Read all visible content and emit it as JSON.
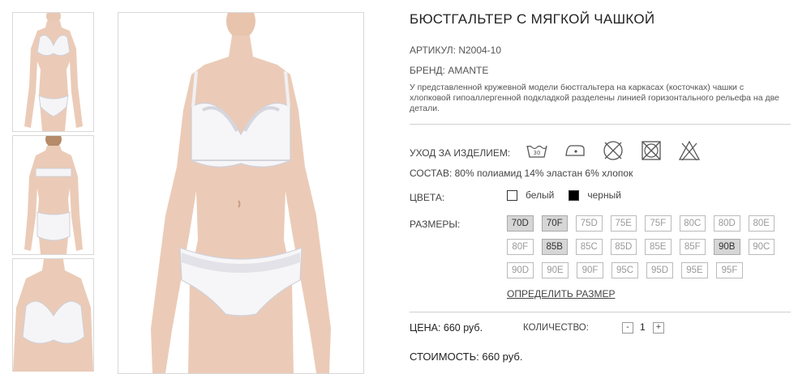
{
  "product": {
    "title": "БЮСТГАЛЬТЕР С МЯГКОЙ ЧАШКОЙ",
    "article": "АРТИКУЛ: N2004-10",
    "brand": "БРЕНД: AMANTE",
    "description": "У представленной кружевной модели бюстгальтера на каркасах (косточках) чашки с хлопковой гипоаллергенной подкладкой разделены линией горизонтального рельефа на две детали."
  },
  "care": {
    "label": "УХОД ЗА ИЗДЕЛИЕМ:",
    "icons": [
      "wash-30-icon",
      "iron-low-icon",
      "no-dry-clean-icon",
      "no-tumble-dry-icon",
      "no-bleach-icon"
    ]
  },
  "composition": "СОСТАВ: 80% полиамид 14% эластан 6% хлопок",
  "colors": {
    "label": "ЦВЕТА:",
    "options": [
      {
        "label": "белый",
        "hex": "#ffffff"
      },
      {
        "label": "черный",
        "hex": "#000000"
      }
    ]
  },
  "sizes": {
    "label": "РАЗМЕРЫ:",
    "rows": [
      [
        {
          "v": "70D",
          "available": true
        },
        {
          "v": "70F",
          "available": true
        },
        {
          "v": "75D",
          "available": false
        },
        {
          "v": "75E",
          "available": false
        },
        {
          "v": "75F",
          "available": false
        },
        {
          "v": "80C",
          "available": false
        },
        {
          "v": "80D",
          "available": false
        },
        {
          "v": "80E",
          "available": false
        }
      ],
      [
        {
          "v": "80F",
          "available": false
        },
        {
          "v": "85B",
          "available": true
        },
        {
          "v": "85C",
          "available": false
        },
        {
          "v": "85D",
          "available": false
        },
        {
          "v": "85E",
          "available": false
        },
        {
          "v": "85F",
          "available": false
        },
        {
          "v": "90B",
          "available": true
        },
        {
          "v": "90C",
          "available": false
        }
      ],
      [
        {
          "v": "90D",
          "available": false
        },
        {
          "v": "90E",
          "available": false
        },
        {
          "v": "90F",
          "available": false
        },
        {
          "v": "95C",
          "available": false
        },
        {
          "v": "95D",
          "available": false
        },
        {
          "v": "95E",
          "available": false
        },
        {
          "v": "95F",
          "available": false
        }
      ]
    ],
    "size_guide_link": "ОПРЕДЕЛИТЬ РАЗМЕР"
  },
  "price": {
    "label": "ЦЕНА: 660 руб.",
    "quantity_label": "КОЛИЧЕСТВО:",
    "quantity": "1",
    "minus": "-",
    "plus": "+",
    "total": "СТОИМОСТЬ: 660 руб."
  }
}
